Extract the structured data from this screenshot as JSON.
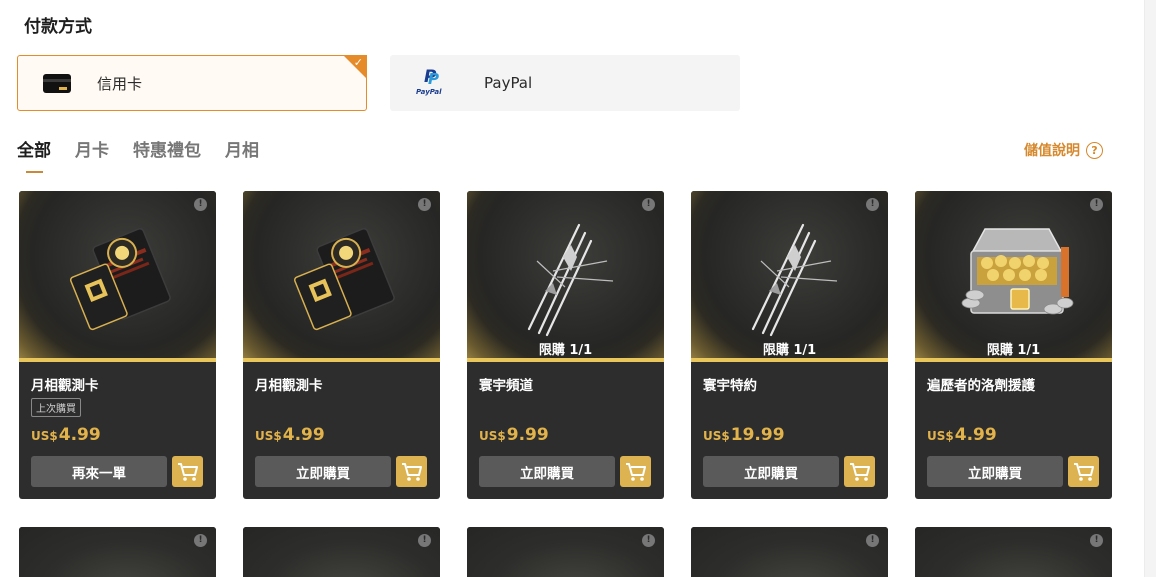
{
  "section_title": "付款方式",
  "payment_methods": [
    {
      "label": "信用卡",
      "selected": true,
      "icon": "credit-card-icon"
    },
    {
      "label": "PayPal",
      "selected": false,
      "icon": "paypal-logo-icon",
      "logo_text": "PayPal"
    }
  ],
  "selected_check": "✓",
  "tabs": [
    {
      "label": "全部",
      "active": true
    },
    {
      "label": "月卡",
      "active": false
    },
    {
      "label": "特惠禮包",
      "active": false
    },
    {
      "label": "月相",
      "active": false
    }
  ],
  "charge_info": {
    "label": "儲值說明",
    "icon": "question-circle-icon",
    "symbol": "?"
  },
  "info_symbol": "!",
  "products": [
    {
      "name": "月相觀測卡",
      "badge": "上次購買",
      "limit": "",
      "currency": "US$",
      "price": "4.99",
      "button": "再來一單",
      "art": "moon-observation-card"
    },
    {
      "name": "月相觀測卡",
      "badge": "",
      "limit": "",
      "currency": "US$",
      "price": "4.99",
      "button": "立即購買",
      "art": "moon-observation-card"
    },
    {
      "name": "寰宇頻道",
      "badge": "",
      "limit": "限購 1/1",
      "currency": "US$",
      "price": "9.99",
      "button": "立即購買",
      "art": "crossed-blades"
    },
    {
      "name": "寰宇特約",
      "badge": "",
      "limit": "限購 1/1",
      "currency": "US$",
      "price": "19.99",
      "button": "立即購買",
      "art": "crossed-blades"
    },
    {
      "name": "遍歷者的洛劑援護",
      "badge": "",
      "limit": "限購 1/1",
      "currency": "US$",
      "price": "4.99",
      "button": "立即購買",
      "art": "treasure-chest"
    }
  ],
  "colors": {
    "accent": "#e58b2a",
    "gold": "#ddb352",
    "price": "#e2b34a",
    "card_bg": "#2d2d2d",
    "tab_underline": "#c8893b"
  }
}
